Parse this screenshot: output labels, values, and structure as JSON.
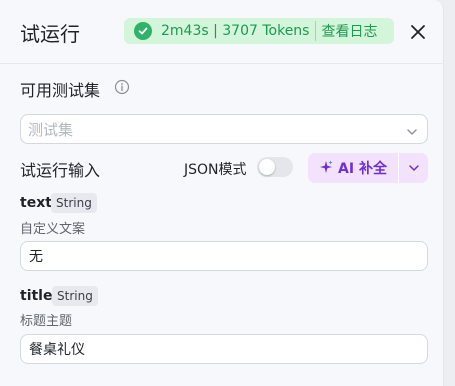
{
  "header": {
    "title": "试运行",
    "status": {
      "summary": "2m43s | 3707 Tokens",
      "log_link": "查看日志",
      "color": "#1d9a52",
      "background": "#d3f5d9",
      "icon": "check-circle-icon"
    },
    "close_icon": "close-icon"
  },
  "testset": {
    "label": "可用测试集",
    "info_icon": "info-icon",
    "placeholder": "测试集",
    "chevron_icon": "chevron-down-icon"
  },
  "run_input": {
    "label": "试运行输入",
    "json_mode_label": "JSON模式",
    "json_mode_enabled": false,
    "ai_button": {
      "label": "AI 补全",
      "icon": "sparkle-icon",
      "dropdown_icon": "chevron-down-icon",
      "color": "#6f2fd6",
      "background": "#f2e2fb"
    }
  },
  "fields": [
    {
      "name": "text",
      "type": "String",
      "description": "自定义文案",
      "value": "无"
    },
    {
      "name": "title",
      "type": "String",
      "description": "标题主题",
      "value": "餐桌礼仪"
    }
  ]
}
